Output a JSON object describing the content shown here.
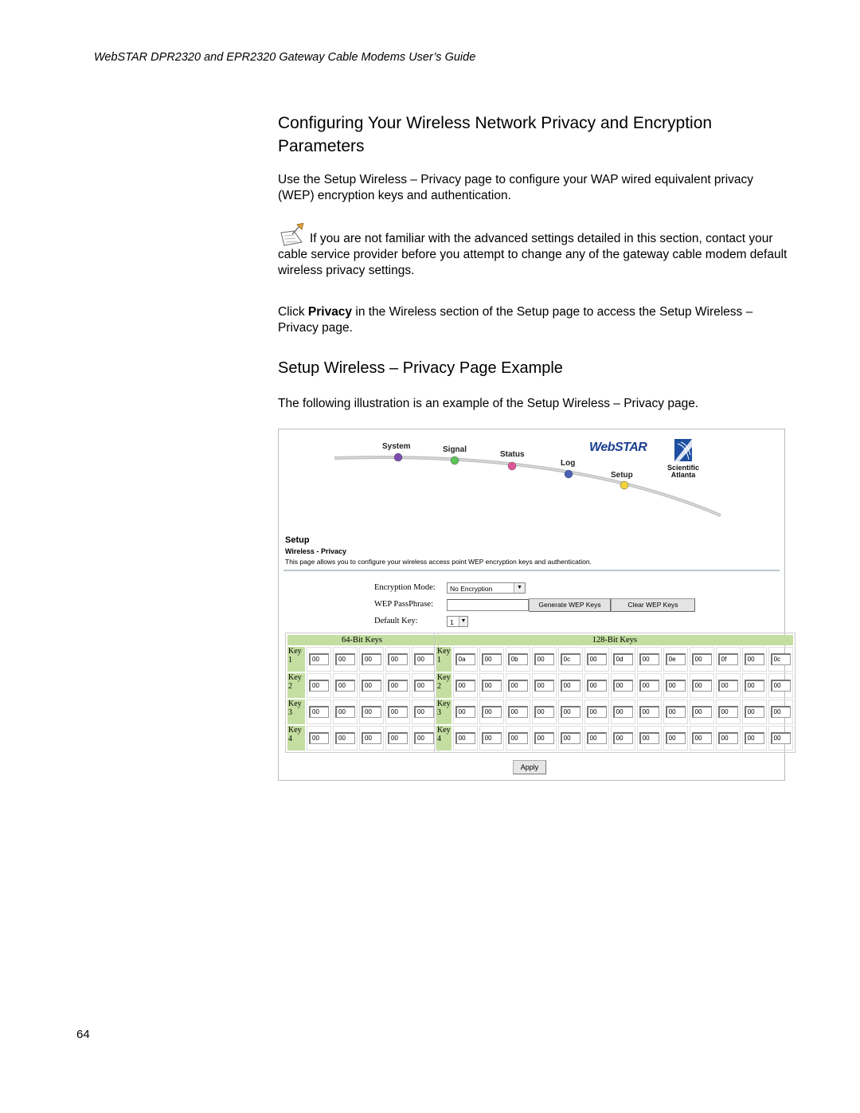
{
  "header": {
    "running_title": "WebSTAR DPR2320 and EPR2320 Gateway Cable Modems User’s Guide"
  },
  "section": {
    "title": "Configuring Your Wireless Network Privacy and Encryption Parameters",
    "intro": "Use the Setup Wireless – Privacy page to configure your WAP wired equivalent privacy (WEP) encryption keys and authentication.",
    "note_icon": "note-pushpin-icon",
    "note": "If you are not familiar with the advanced settings detailed in this section, contact your cable service provider before you attempt to change any of the gateway cable modem default wireless privacy settings.",
    "click_pre": "Click ",
    "click_bold": "Privacy",
    "click_post": " in the Wireless section of the Setup page to access the Setup Wireless – Privacy page."
  },
  "subsection": {
    "title": "Setup Wireless – Privacy Page Example",
    "intro": "The following illustration is an example of the Setup Wireless – Privacy page."
  },
  "screenshot": {
    "nav": [
      "System",
      "Signal",
      "Status",
      "Log",
      "Setup"
    ],
    "nav_colors": [
      "#7a4bb0",
      "#5cc45a",
      "#e0559a",
      "#4a5fb8",
      "#f2d23a"
    ],
    "logo_webstar": "WebSTAR",
    "logo_sa_line1": "Scientific",
    "logo_sa_line2": "Atlanta",
    "page_title": "Setup",
    "page_subtitle": "Wireless - Privacy",
    "page_description": "This page allows you to configure your wireless access point WEP encryption keys and authentication.",
    "encryption_mode_label": "Encryption Mode:",
    "encryption_mode_value": "No Encryption",
    "passphrase_label": "WEP PassPhrase:",
    "passphrase_value": "",
    "generate_button": "Generate WEP Keys",
    "clear_button": "Clear WEP Keys",
    "default_key_label": "Default Key:",
    "default_key_value": "1",
    "keys64": {
      "header": "64-Bit Keys",
      "rows": [
        {
          "label1": "Key",
          "label2": "1",
          "values": [
            "00",
            "00",
            "00",
            "00",
            "00"
          ]
        },
        {
          "label1": "Key",
          "label2": "2",
          "values": [
            "00",
            "00",
            "00",
            "00",
            "00"
          ]
        },
        {
          "label1": "Key",
          "label2": "3",
          "values": [
            "00",
            "00",
            "00",
            "00",
            "00"
          ]
        },
        {
          "label1": "Key",
          "label2": "4",
          "values": [
            "00",
            "00",
            "00",
            "00",
            "00"
          ]
        }
      ]
    },
    "keys128": {
      "header": "128-Bit Keys",
      "rows": [
        {
          "label1": "Key",
          "label2": "1",
          "values": [
            "0a",
            "00",
            "0b",
            "00",
            "0c",
            "00",
            "0d",
            "00",
            "0e",
            "00",
            "0f",
            "00",
            "0c"
          ]
        },
        {
          "label1": "Key",
          "label2": "2",
          "values": [
            "00",
            "00",
            "00",
            "00",
            "00",
            "00",
            "00",
            "00",
            "00",
            "00",
            "00",
            "00",
            "00"
          ]
        },
        {
          "label1": "Key",
          "label2": "3",
          "values": [
            "00",
            "00",
            "00",
            "00",
            "00",
            "00",
            "00",
            "00",
            "00",
            "00",
            "00",
            "00",
            "00"
          ]
        },
        {
          "label1": "Key",
          "label2": "4",
          "values": [
            "00",
            "00",
            "00",
            "00",
            "00",
            "00",
            "00",
            "00",
            "00",
            "00",
            "00",
            "00",
            "00"
          ]
        }
      ]
    },
    "apply_button": "Apply"
  },
  "footer": {
    "page_number": "64"
  }
}
